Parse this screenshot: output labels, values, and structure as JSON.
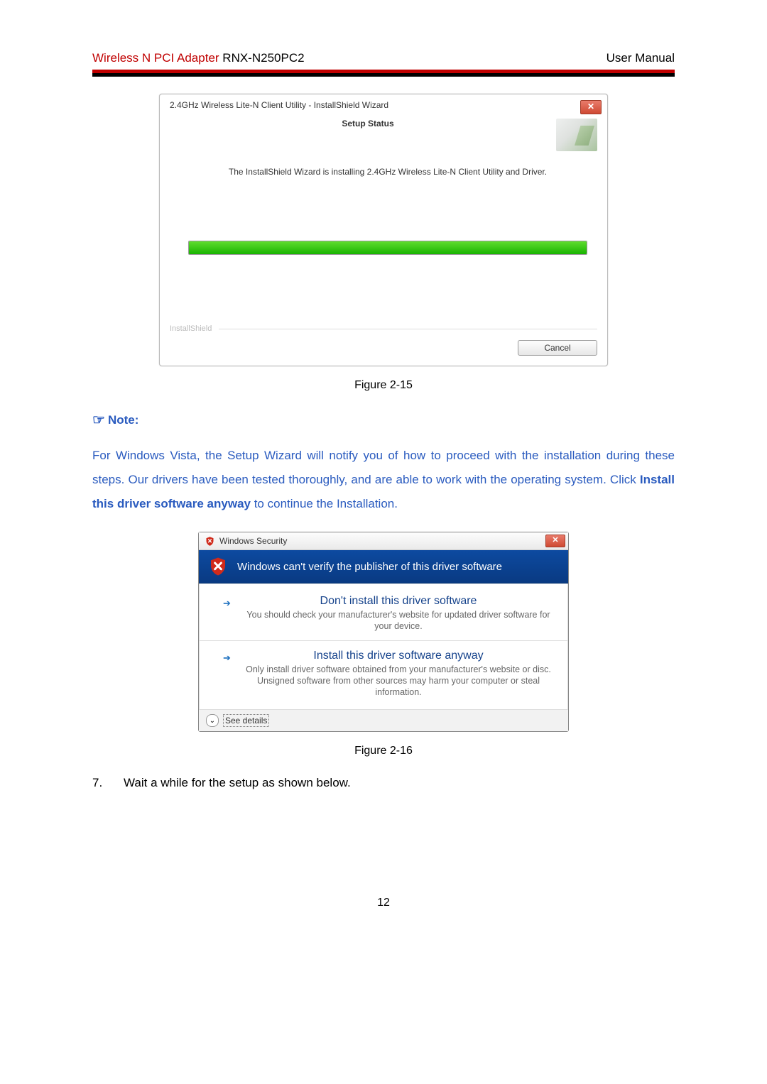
{
  "header": {
    "left_red": "Wireless N PCI Adapter",
    "left_black": " RNX-N250PC2",
    "right": "User Manual"
  },
  "wizard": {
    "title": "2.4GHz Wireless Lite-N Client Utility - InstallShield Wizard",
    "close_glyph": "✕",
    "setup_status": "Setup Status",
    "message": "The InstallShield Wizard is installing 2.4GHz Wireless Lite-N Client Utility and Driver.",
    "brand": "InstallShield",
    "cancel": "Cancel"
  },
  "caption_15": "Figure 2-15",
  "note": {
    "label": "Note:",
    "body_pre": "For Windows Vista, the Setup Wizard will notify you of how to proceed with the installation during these steps. Our drivers have been tested thoroughly, and are able to work with the operating system. Click ",
    "body_bold": "Install this driver software anyway",
    "body_post": " to continue the Installation."
  },
  "winsec": {
    "title": "Windows Security",
    "close_glyph": "✕",
    "heading": "Windows can't verify the publisher of this driver software",
    "opt1_title": "Don't install this driver software",
    "opt1_desc": "You should check your manufacturer's website for updated driver software for your device.",
    "opt2_title": "Install this driver software anyway",
    "opt2_desc": "Only install driver software obtained from your manufacturer's website or disc. Unsigned software from other sources may harm your computer or steal information.",
    "expand_glyph": "⌄",
    "see_details": "See details"
  },
  "caption_16": "Figure 2-16",
  "step7": {
    "num": "7.",
    "text": "Wait a while for the setup as shown below."
  },
  "page_number": "12"
}
